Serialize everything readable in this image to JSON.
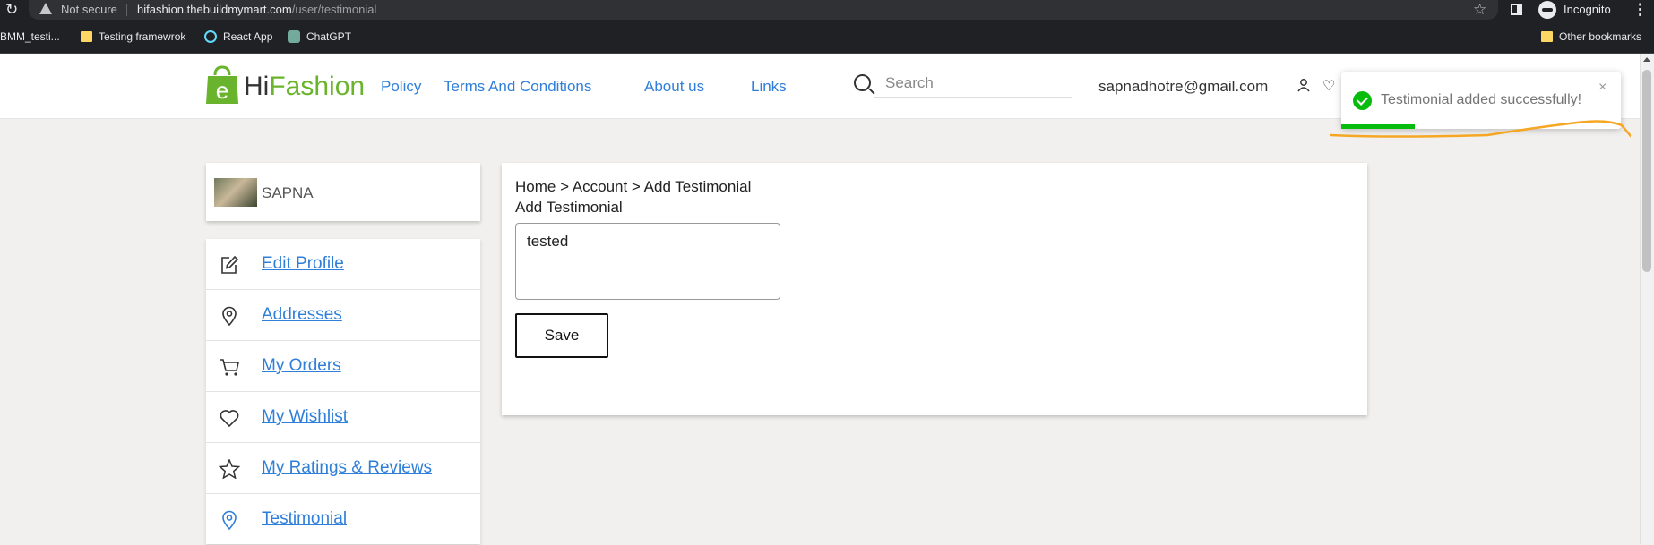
{
  "browser": {
    "security_label": "Not secure",
    "url_host": "hifashion.thebuildmymart.com",
    "url_path": "/user/testimonial",
    "incognito_label": "Incognito",
    "bookmarks": [
      "BMM_testi...",
      "Testing framewrok",
      "React App",
      "ChatGPT"
    ],
    "other_bookmarks": "Other bookmarks"
  },
  "header": {
    "logo_prefix": "Hi",
    "logo_suffix": "Fashion",
    "nav": [
      "Policy",
      "Terms And Conditions",
      "About us",
      "Links"
    ],
    "search_placeholder": "Search",
    "user_email": "sapnadhotre@gmail.com"
  },
  "toast": {
    "message": "Testimonial added successfully!",
    "close": "×",
    "status_color": "#07bc0c"
  },
  "profile": {
    "name": "SAPNA"
  },
  "menu": {
    "items": [
      {
        "label": "Edit Profile",
        "icon": "edit-icon"
      },
      {
        "label": "Addresses",
        "icon": "location-pin-icon"
      },
      {
        "label": "My Orders",
        "icon": "cart-icon"
      },
      {
        "label": "My Wishlist",
        "icon": "heart-icon"
      },
      {
        "label": "My Ratings & Reviews",
        "icon": "star-icon"
      },
      {
        "label": "Testimonial",
        "icon": "location-pin-icon"
      }
    ]
  },
  "main": {
    "breadcrumb": "Home > Account > Add Testimonial",
    "title": "Add Testimonial",
    "textarea_value": "tested",
    "save_label": "Save"
  },
  "colors": {
    "brand_green": "#6ab42d",
    "link_blue": "#2f7fd9"
  }
}
